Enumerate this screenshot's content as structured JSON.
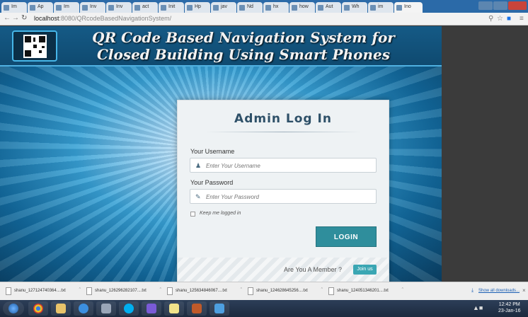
{
  "browser": {
    "tabs": [
      {
        "label": "Im"
      },
      {
        "label": "Ap"
      },
      {
        "label": "Im"
      },
      {
        "label": "Inv"
      },
      {
        "label": "Inv"
      },
      {
        "label": "act"
      },
      {
        "label": "Init"
      },
      {
        "label": "Hp"
      },
      {
        "label": "jav"
      },
      {
        "label": "Nd"
      },
      {
        "label": "hx"
      },
      {
        "label": "how"
      },
      {
        "label": "Aut"
      },
      {
        "label": "Wh"
      },
      {
        "label": "im"
      },
      {
        "label": "Ino"
      }
    ],
    "url_host": "localhost",
    "url_path": ":8080/QRcodeBasedNavigationSystem/"
  },
  "header": {
    "title_line1": "QR Code Based Navigation System for",
    "title_line2": "Closed Building Using Smart Phones"
  },
  "login": {
    "title": "Admin Log In",
    "username_label": "Your Username",
    "username_placeholder": "Enter Your Username",
    "password_label": "Your Password",
    "password_placeholder": "Enter Your Password",
    "keep_logged_in": "Keep me logged in",
    "login_button": "LOGIN",
    "member_text": "Are You A Member ?",
    "join_button": "Join us"
  },
  "downloads": {
    "items": [
      {
        "name": "shanu_127124740364....txt"
      },
      {
        "name": "shanu_126296282107....txt"
      },
      {
        "name": "shanu_125634846067....txt"
      },
      {
        "name": "shanu_124628645256....txt"
      },
      {
        "name": "shanu_124051346201....txt"
      }
    ],
    "show_all": "Show all downloads..."
  },
  "taskbar": {
    "time": "12:42 PM",
    "date": "23-Jan-16"
  }
}
